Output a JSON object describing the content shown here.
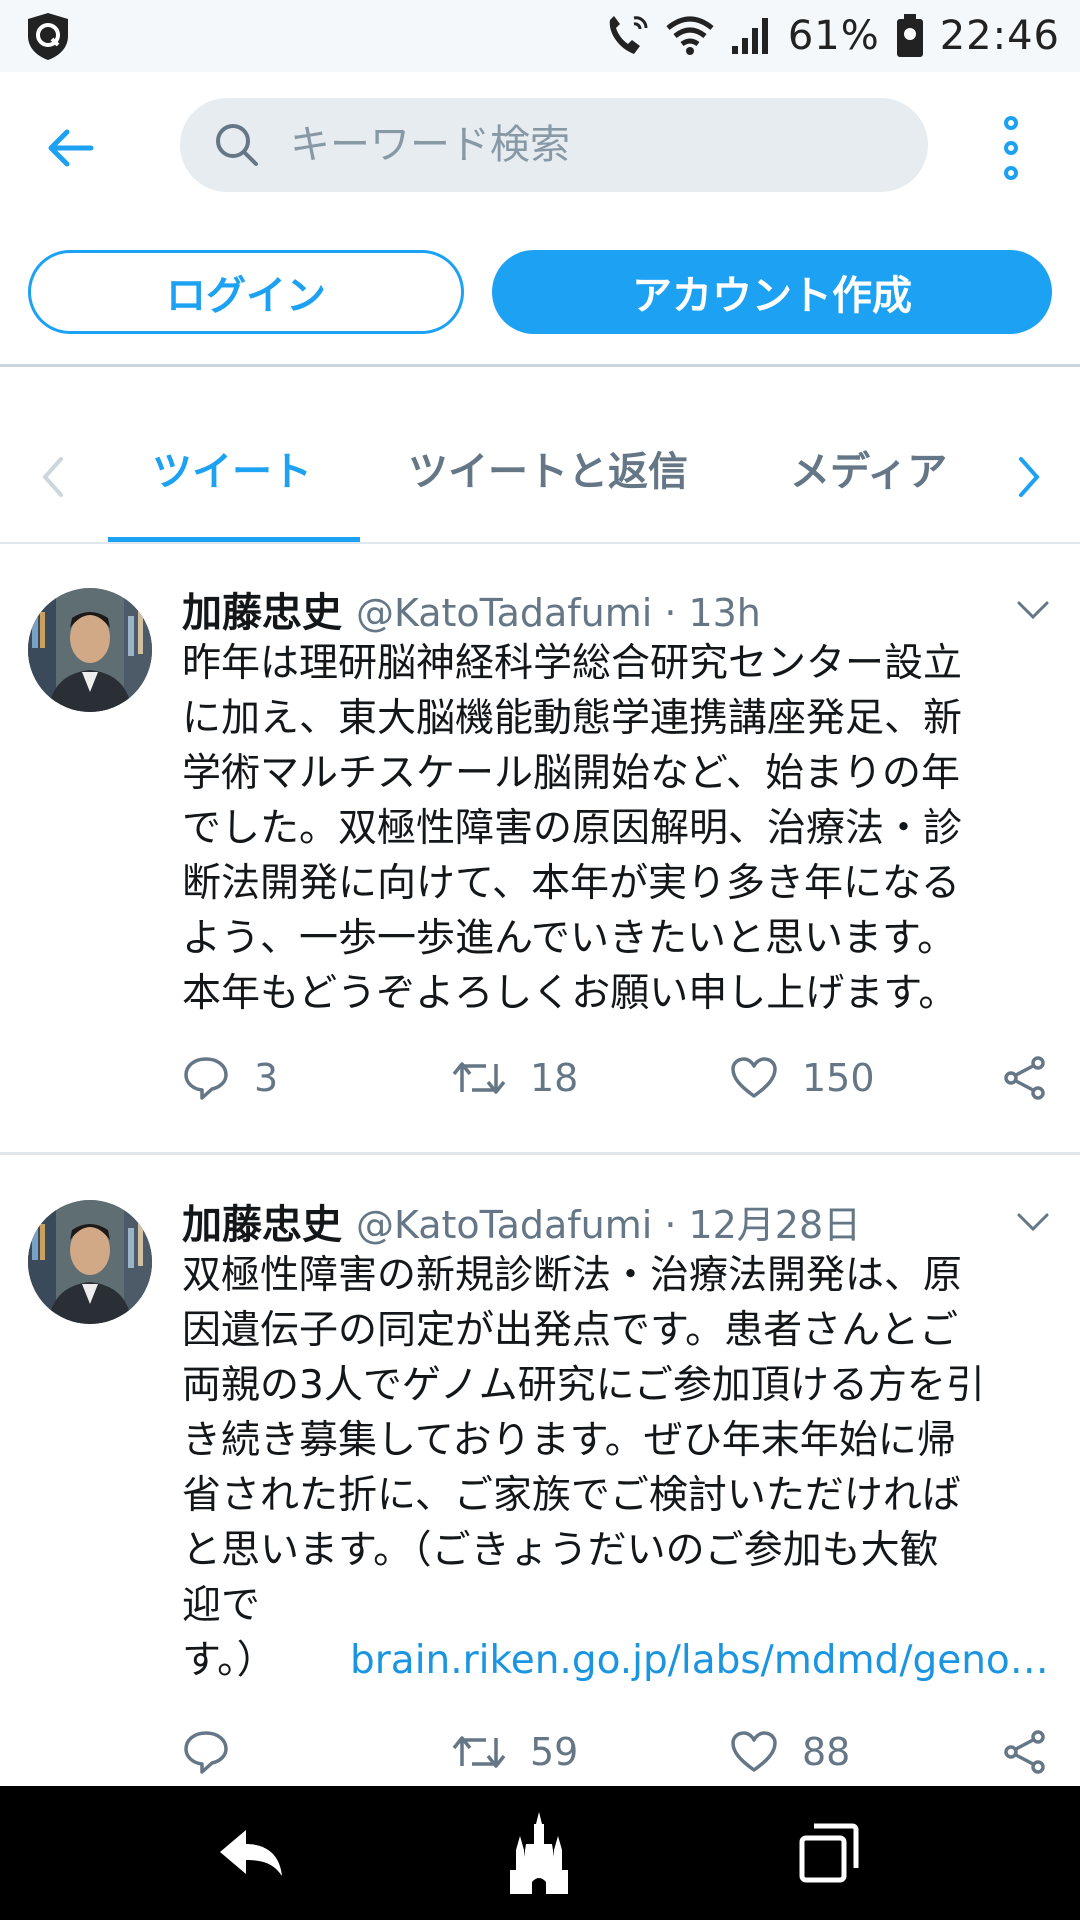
{
  "status_bar": {
    "battery": "61%",
    "time": "22:46"
  },
  "search": {
    "placeholder": "キーワード検索"
  },
  "auth": {
    "login_label": "ログイン",
    "signup_label": "アカウント作成"
  },
  "tabs": [
    {
      "label": "ツイート",
      "active": true
    },
    {
      "label": "ツイートと返信",
      "active": false
    },
    {
      "label": "メディア",
      "active": false
    }
  ],
  "tweets": [
    {
      "name": "加藤忠史",
      "handle": "@KatoTadafumi",
      "time": "13h",
      "text": "昨年は理研脳神経科学総合研究センター設立\nに加え、東大脳機能動態学連携講座発足、新\n学術マルチスケール脳開始など、始まりの年\nでした。双極性障害の原因解明、治療法・診\n断法開発に向けて、本年が実り多き年になる\nよう、一歩一歩進んでいきたいと思います。\n本年もどうぞよろしくお願い申し上げます。",
      "link": "",
      "replies": "3",
      "retweets": "18",
      "likes": "150"
    },
    {
      "name": "加藤忠史",
      "handle": "@KatoTadafumi",
      "time": "12月28日",
      "text": "双極性障害の新規診断法・治療法開発は、原\n因遺伝子の同定が出発点です。患者さんとご\n両親の3人でゲノム研究にご参加頂ける方を引\nき続き募集しております。ぜひ年末年始に帰\n省された折に、ご家族でご検討いただければ\nと思います。（ごきょうだいのご参加も大歓\n迎で\nす。）",
      "link": "brain.riken.go.jp/labs/mdmd/geno…",
      "replies": "",
      "retweets": "59",
      "likes": "88"
    }
  ],
  "colors": {
    "accent": "#1da1f2",
    "secondary_text": "#657786",
    "nav_bar": "#000000"
  },
  "icons": {
    "status_left": "shield-app-icon",
    "status_right": [
      "wifi-call-icon",
      "wifi-icon",
      "signal-icon",
      "battery-icon"
    ],
    "nav": [
      "back-arrow-icon",
      "castle-icon",
      "recents-icon"
    ]
  }
}
